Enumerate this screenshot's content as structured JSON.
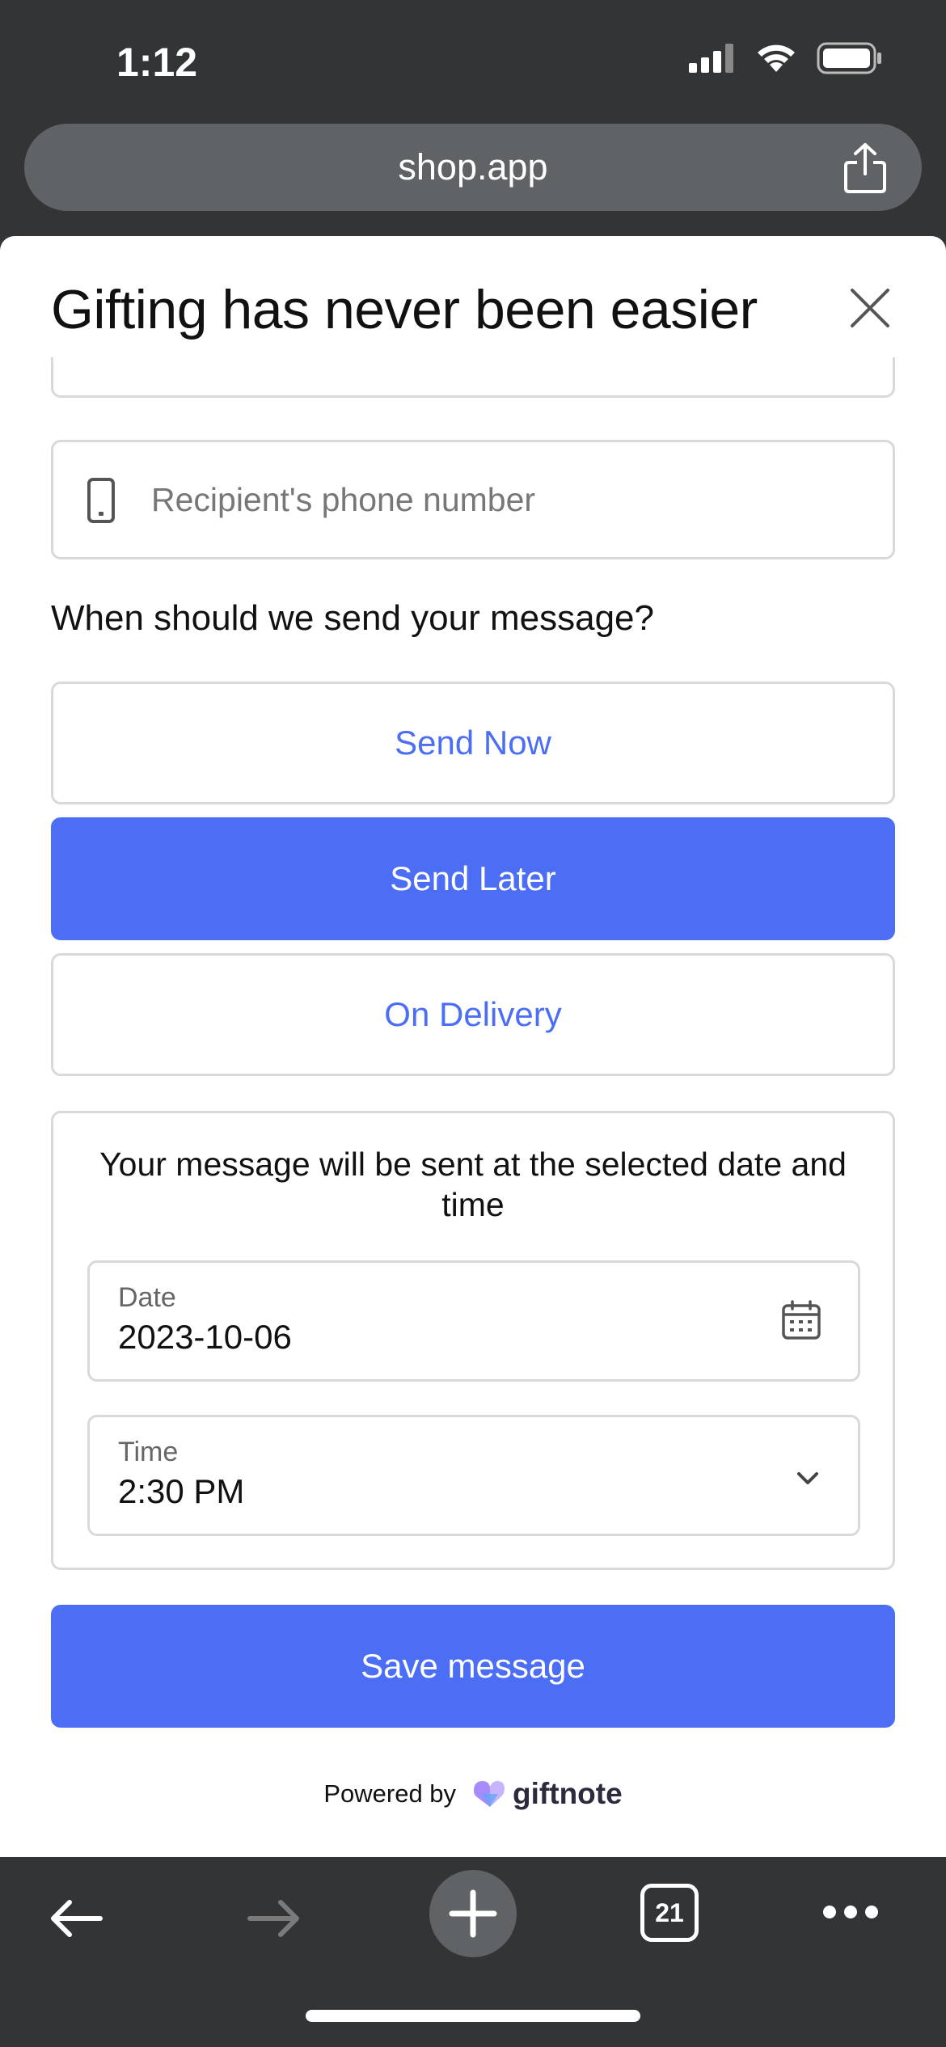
{
  "status_bar": {
    "time": "1:12"
  },
  "browser": {
    "url": "shop.app",
    "tab_count": "21"
  },
  "sheet": {
    "title": "Gifting has never been easier",
    "phone_placeholder": "Recipient's phone number",
    "when_label": "When should we send your message?",
    "options": [
      "Send Now",
      "Send Later",
      "On Delivery"
    ],
    "selected_option": "Send Later",
    "schedule_description": "Your message will be sent at the selected date and time",
    "date": {
      "label": "Date",
      "value": "2023-10-06"
    },
    "time": {
      "label": "Time",
      "value": "2:30 PM"
    },
    "save_label": "Save message",
    "powered_by_label": "Powered by",
    "brand_name": "giftnote"
  },
  "colors": {
    "accent": "#4c6ef5",
    "chrome": "#333436",
    "border": "#d9d9d9"
  },
  "icons": [
    "signal-icon",
    "wifi-icon",
    "battery-icon",
    "share-icon",
    "close-icon",
    "phone-icon",
    "calendar-icon",
    "chevron-down-icon",
    "giftnote-logo-icon",
    "back-arrow-icon",
    "forward-arrow-icon",
    "new-tab-icon",
    "tabs-count-icon",
    "more-icon"
  ]
}
